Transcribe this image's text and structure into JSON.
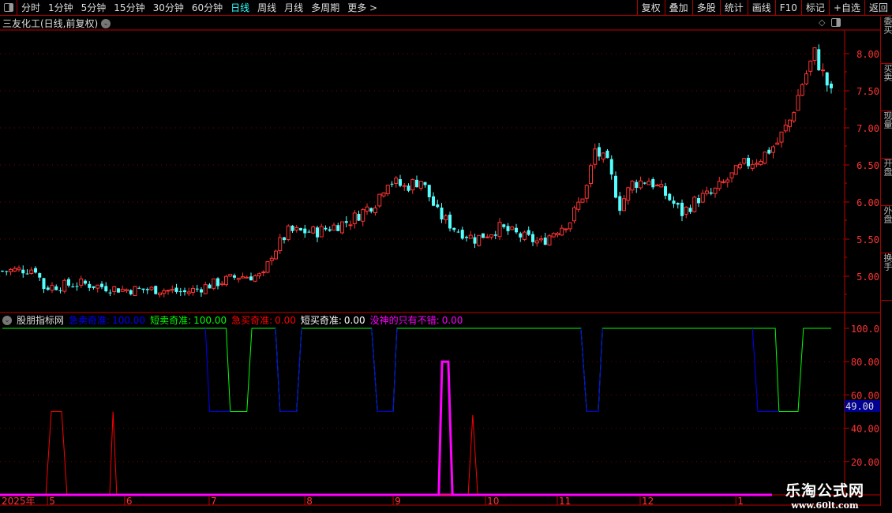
{
  "toolbar": {
    "periods": [
      "分时",
      "1分钟",
      "5分钟",
      "15分钟",
      "30分钟",
      "60分钟",
      "日线",
      "周线",
      "月线",
      "多周期",
      "更多 >"
    ],
    "active": "日线",
    "right_buttons": [
      "复权",
      "叠加",
      "多股",
      "统计",
      "画线",
      "F10",
      "标记",
      "+自选",
      "返回"
    ]
  },
  "stock_title": "三友化工(日线,前复权)",
  "main_axis": {
    "ticks": [
      8.0,
      7.5,
      7.0,
      6.5,
      6.0,
      5.5,
      5.0
    ],
    "labels": [
      "8.00",
      "7.50",
      "7.00",
      "6.50",
      "6.00",
      "5.50",
      "5.00"
    ]
  },
  "colors": {
    "up": "#ff3232",
    "down": "#54ffff",
    "axis": "#c00000",
    "blue": "#0000ff",
    "green": "#00ff00",
    "red": "#ff0000",
    "magenta": "#ff00ff"
  },
  "price_path": [
    [
      0,
      5.07
    ],
    [
      8,
      5.1
    ],
    [
      10,
      4.85
    ],
    [
      19,
      4.9
    ],
    [
      29,
      4.82
    ],
    [
      38,
      4.82
    ],
    [
      44,
      4.78
    ],
    [
      50,
      4.88
    ],
    [
      57,
      5.0
    ],
    [
      63,
      5.0
    ],
    [
      65,
      5.3
    ],
    [
      69,
      5.6
    ],
    [
      76,
      5.6
    ],
    [
      84,
      5.75
    ],
    [
      90,
      6.0
    ],
    [
      93,
      6.3
    ],
    [
      97,
      6.2
    ],
    [
      101,
      6.3
    ],
    [
      105,
      5.85
    ],
    [
      109,
      5.65
    ],
    [
      114,
      5.5
    ],
    [
      120,
      5.65
    ],
    [
      126,
      5.52
    ],
    [
      130,
      5.45
    ],
    [
      133,
      5.6
    ],
    [
      137,
      5.75
    ],
    [
      141,
      6.2
    ],
    [
      143,
      6.7
    ],
    [
      146,
      6.5
    ],
    [
      149,
      5.95
    ],
    [
      152,
      6.25
    ],
    [
      156,
      6.3
    ],
    [
      160,
      6.1
    ],
    [
      164,
      5.85
    ],
    [
      168,
      6.05
    ],
    [
      171,
      6.1
    ],
    [
      175,
      6.3
    ],
    [
      179,
      6.5
    ],
    [
      183,
      6.6
    ],
    [
      187,
      6.8
    ],
    [
      190,
      7.1
    ],
    [
      193,
      7.6
    ],
    [
      196,
      8.0
    ],
    [
      200,
      7.45
    ]
  ],
  "indicator": {
    "name": "股朋指标网",
    "items": [
      {
        "label": "急卖奇准:",
        "value": "100.00",
        "color": "#0000ff"
      },
      {
        "label": "短卖奇准:",
        "value": "100.00",
        "color": "#00ff00"
      },
      {
        "label": "急买奇准:",
        "value": "0.00",
        "color": "#ff0000"
      },
      {
        "label": "短买奇准:",
        "value": "0.00",
        "color": "#ffffff"
      },
      {
        "label": "没神的只有不错:",
        "value": "0.00",
        "color": "#ff00ff"
      }
    ],
    "axis_labels": [
      "100.0",
      "80.00",
      "60.00",
      "40.00",
      "20.00"
    ],
    "axis_values": [
      100,
      80,
      60,
      40,
      20
    ],
    "current_label": "49.00",
    "green": [
      [
        0,
        100
      ],
      [
        54,
        100
      ],
      [
        55,
        50
      ],
      [
        59,
        50
      ],
      [
        60.2,
        100
      ],
      [
        65.9,
        100
      ],
      [
        67,
        50
      ],
      [
        71,
        50
      ],
      [
        72.2,
        100
      ],
      [
        89.1,
        100
      ],
      [
        90.5,
        50
      ],
      [
        94.3,
        50
      ],
      [
        95.2,
        100
      ],
      [
        139.6,
        100
      ],
      [
        141,
        50
      ],
      [
        143.8,
        50
      ],
      [
        144.8,
        100
      ],
      [
        186.5,
        100
      ],
      [
        187.4,
        50
      ],
      [
        192,
        50
      ],
      [
        193.3,
        100
      ],
      [
        200,
        100
      ]
    ],
    "blue": [
      [
        [
          49,
          100
        ],
        [
          50,
          50
        ],
        [
          55,
          50
        ]
      ],
      [
        [
          65.9,
          100
        ],
        [
          67,
          50
        ],
        [
          71,
          50
        ],
        [
          72.2,
          100
        ]
      ],
      [
        [
          89.1,
          100
        ],
        [
          90.5,
          50
        ],
        [
          94.3,
          50
        ],
        [
          95.2,
          100
        ]
      ],
      [
        [
          139.6,
          100
        ],
        [
          141,
          50
        ],
        [
          143.8,
          50
        ],
        [
          144.8,
          100
        ]
      ],
      [
        [
          181,
          100
        ],
        [
          182.3,
          50
        ],
        [
          187.4,
          50
        ]
      ]
    ],
    "red": [
      [
        0,
        0
      ],
      [
        10.5,
        0
      ],
      [
        11.8,
        50
      ],
      [
        14.3,
        50
      ],
      [
        15.6,
        0
      ],
      [
        25.9,
        0
      ],
      [
        26.7,
        50
      ],
      [
        27.6,
        0
      ],
      [
        112.4,
        0
      ],
      [
        113.5,
        48
      ],
      [
        114.7,
        0
      ],
      [
        185.7,
        0
      ]
    ],
    "magenta": [
      [
        0,
        0
      ],
      [
        105.3,
        0
      ],
      [
        106.1,
        80
      ],
      [
        107.6,
        80
      ],
      [
        108.6,
        0
      ],
      [
        185.7,
        0
      ]
    ]
  },
  "date_axis": {
    "year": "2025年",
    "months": [
      {
        "label": "5",
        "day": 10.9
      },
      {
        "label": "6",
        "day": 29.5
      },
      {
        "label": "7",
        "day": 49.9
      },
      {
        "label": "8",
        "day": 73
      },
      {
        "label": "9",
        "day": 94.3
      },
      {
        "label": "10",
        "day": 116.6
      },
      {
        "label": "11",
        "day": 133.9
      },
      {
        "label": "12",
        "day": 153.9
      },
      {
        "label": "1",
        "day": 177
      }
    ]
  },
  "sidebar": [
    "委买",
    "买卖",
    "现量",
    "开盘",
    "外盘",
    "换手"
  ],
  "watermark": {
    "name": "乐淘公式网",
    "url": "www.60lt.com"
  }
}
